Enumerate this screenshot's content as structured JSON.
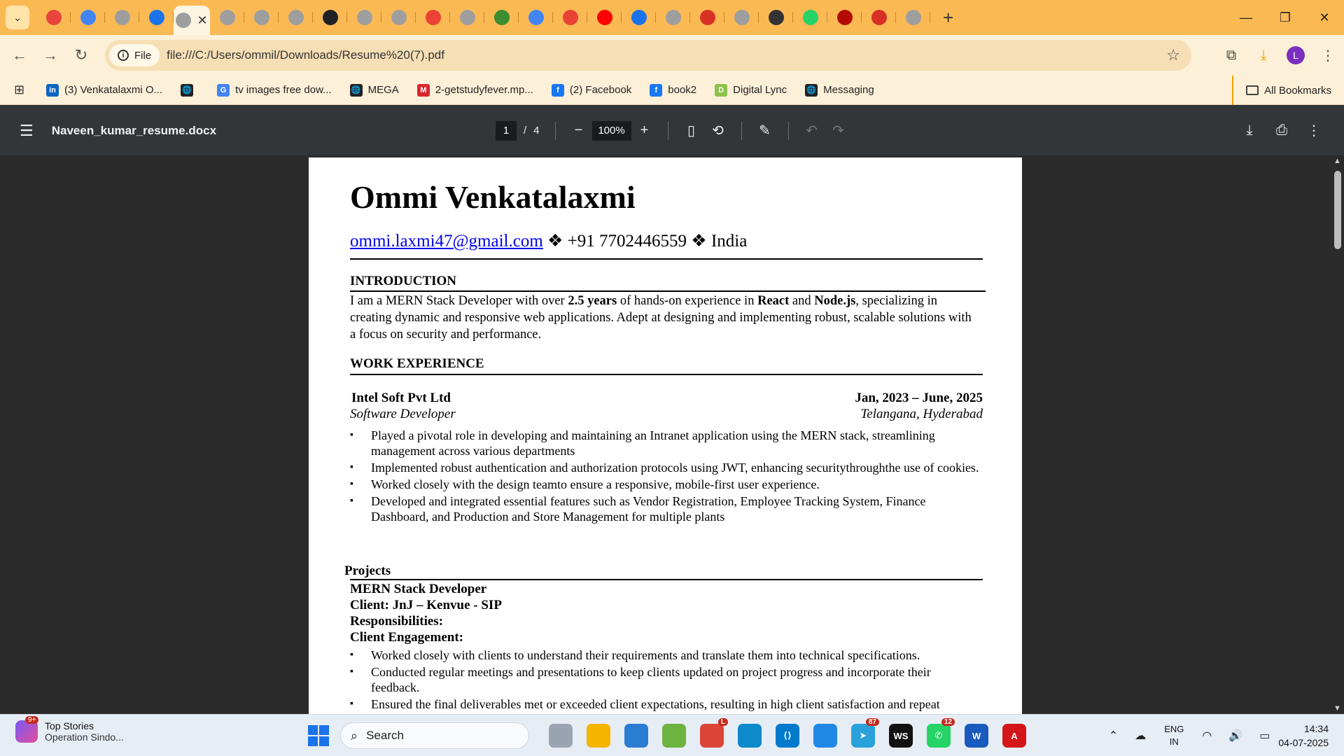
{
  "browser": {
    "tab_colors": [
      "#e8453c",
      "#4285f4",
      "#9e9e9e",
      "#1a73e8",
      "#9e9e9e",
      "#9e9e9e",
      "#9e9e9e",
      "#9e9e9e",
      "#202124",
      "#9e9e9e",
      "#9e9e9e",
      "#ea4335",
      "#9e9e9e",
      "#3c8d2f",
      "#4285f4",
      "#ea4335",
      "#ff0000",
      "#1a73e8",
      "#9e9e9e",
      "#d93025",
      "#9e9e9e",
      "#333333",
      "#25d366",
      "#b30b00",
      "#d93025",
      "#9e9e9e"
    ],
    "active_tab_close": "✕",
    "address": {
      "chip_label": "File",
      "url": "file:///C:/Users/ommil/Downloads/Resume%20(7).pdf"
    },
    "profile_initial": "L",
    "bookmarks": [
      {
        "label": "(3) Venkatalaxmi O...",
        "icon": "linkedin-icon",
        "color": "#0a66c2",
        "glyph": "in"
      },
      {
        "label": "",
        "icon": "globe-icon",
        "color": "#222222",
        "glyph": "🌐"
      },
      {
        "label": "tv images free dow...",
        "icon": "google-icon",
        "color": "#4285f4",
        "glyph": "G"
      },
      {
        "label": "MEGA",
        "icon": "globe-icon",
        "color": "#222222",
        "glyph": "🌐"
      },
      {
        "label": "2-getstudyfever.mp...",
        "icon": "mega-icon",
        "color": "#d9272e",
        "glyph": "M"
      },
      {
        "label": "(2) Facebook",
        "icon": "facebook-icon",
        "color": "#1877f2",
        "glyph": "f"
      },
      {
        "label": "book2",
        "icon": "facebook-icon",
        "color": "#1877f2",
        "glyph": "f"
      },
      {
        "label": "Digital Lync",
        "icon": "digital-lync-icon",
        "color": "#8bc34a",
        "glyph": "D"
      },
      {
        "label": "Messaging",
        "icon": "globe-icon",
        "color": "#222222",
        "glyph": "🌐"
      }
    ],
    "all_bookmarks": "All Bookmarks"
  },
  "pdf_toolbar": {
    "title": "Naveen_kumar_resume.docx",
    "current_page": "1",
    "page_separator": "/",
    "total_pages": "4",
    "zoom": "100%"
  },
  "resume": {
    "name": "Ommi Venkatalaxmi",
    "email": "ommi.laxmi47@gmail.com",
    "contact_rest": " ❖ +91 7702446559 ❖ India",
    "intro_title": "INTRODUCTION",
    "intro_p1": "I am a MERN Stack Developer with over ",
    "intro_b1": "2.5 years",
    "intro_p2": " of hands-on experience in ",
    "intro_b2": "React",
    "intro_p3": " and ",
    "intro_b3": "Node.js",
    "intro_p4": ", specializing in creating dynamic and responsive web applications. Adept at designing and implementing robust, scalable solutions with a focus on security and performance.",
    "work_title": "WORK  EXPERIENCE",
    "company": "Intel Soft Pvt Ltd",
    "dates": "Jan, 2023 – June, 2025",
    "role": "Software Developer",
    "location": "Telangana, Hyderabad",
    "work_bullets": [
      "Played a pivotal role in developing and maintaining an Intranet application using the MERN stack, streamlining management across various departments",
      "Implemented robust authentication and authorization protocols using JWT, enhancing securitythroughthe use of cookies.",
      "Worked closely with the design teamto ensure a responsive, mobile-first user experience.",
      "Developed and integrated essential features such as Vendor Registration, Employee Tracking System, Finance Dashboard, and Production and Store Management for multiple plants"
    ],
    "projects_title": "Projects",
    "project_role": "MERN Stack Developer",
    "project_client": "Client: JnJ – Kenvue - SIP",
    "responsibilities": "Responsibilities:",
    "client_engagement": "Client Engagement:",
    "project_bullets": [
      "Worked closely with clients to understand their requirements and translate them into technical specifications.",
      "Conducted regular meetings and presentations to keep clients updated on project progress and incorporate their feedback.",
      "Ensured the final deliverables met or exceeded client expectations, resulting in high client satisfaction and repeat"
    ]
  },
  "taskbar": {
    "news_badge": "9+",
    "news_title": "Top Stories",
    "news_sub": "Operation Sindo...",
    "search_label": "Search",
    "apps": [
      {
        "name": "task-view-icon",
        "color": "#9aa4b1",
        "glyph": "",
        "badge": ""
      },
      {
        "name": "file-explorer-icon",
        "color": "#f5b400",
        "glyph": "",
        "badge": ""
      },
      {
        "name": "microsoft-store-icon",
        "color": "#2b7cd3",
        "glyph": "",
        "badge": ""
      },
      {
        "name": "sts-icon",
        "color": "#6db33f",
        "glyph": "",
        "badge": ""
      },
      {
        "name": "chrome-icon",
        "color": "#db4437",
        "glyph": "",
        "badge": "L"
      },
      {
        "name": "edge-icon",
        "color": "#0c8ac9",
        "glyph": "",
        "badge": ""
      },
      {
        "name": "vscode-icon",
        "color": "#007acc",
        "glyph": "⟨⟩",
        "badge": ""
      },
      {
        "name": "paint-icon",
        "color": "#1f88e5",
        "glyph": "",
        "badge": ""
      },
      {
        "name": "telegram-icon",
        "color": "#2aa1da",
        "glyph": "➤",
        "badge": "87"
      },
      {
        "name": "webstorm-icon",
        "color": "#111111",
        "glyph": "WS",
        "badge": ""
      },
      {
        "name": "whatsapp-icon",
        "color": "#25d366",
        "glyph": "✆",
        "badge": "12"
      },
      {
        "name": "word-icon",
        "color": "#185abd",
        "glyph": "W",
        "badge": ""
      },
      {
        "name": "acrobat-icon",
        "color": "#d4161a",
        "glyph": "A",
        "badge": ""
      }
    ],
    "lang_1": "ENG",
    "lang_2": "IN",
    "time": "14:34",
    "date": "04-07-2025"
  }
}
